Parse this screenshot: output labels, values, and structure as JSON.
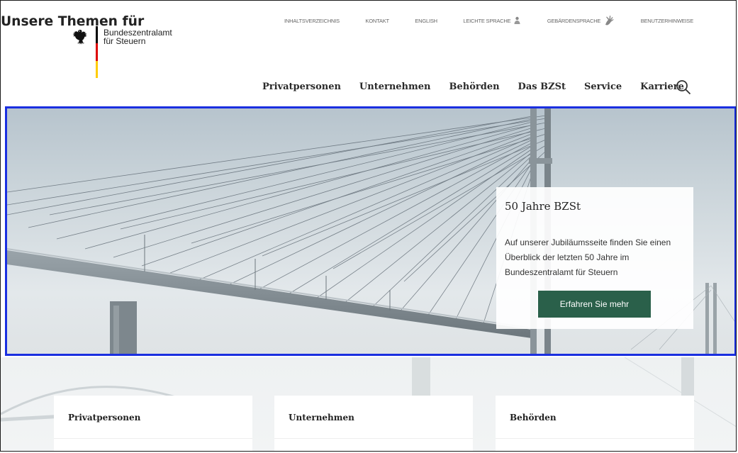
{
  "logo": {
    "line1": "Bundeszentralamt",
    "line2": "für Steuern",
    "flag_colors": [
      "#000000",
      "#dd0000",
      "#ffcc00"
    ]
  },
  "service_nav": [
    {
      "label": "INHALTSVERZEICHNIS"
    },
    {
      "label": "KONTAKT"
    },
    {
      "label": "ENGLISH"
    },
    {
      "label": "LEICHTE SPRACHE",
      "icon": "easy-language-icon"
    },
    {
      "label": "GEBÄRDENSPRACHE",
      "icon": "sign-language-icon"
    },
    {
      "label": "BENUTZERHINWEISE"
    }
  ],
  "main_nav": [
    "Privatpersonen",
    "Unternehmen",
    "Behörden",
    "Das BZSt",
    "Service",
    "Karriere"
  ],
  "hero": {
    "title": "50 Jahre BZSt",
    "text": "Auf unserer Jubiläumsseite finden Sie einen Überblick der letzten 50 Jahre im Bundeszentralamt für Steuern",
    "button": "Erfahren Sie mehr",
    "button_color": "#2a604a",
    "highlight_border": "#1a2fe0"
  },
  "themes": {
    "heading": "Unsere Themen für",
    "cards": [
      "Privatpersonen",
      "Unternehmen",
      "Behörden"
    ]
  }
}
